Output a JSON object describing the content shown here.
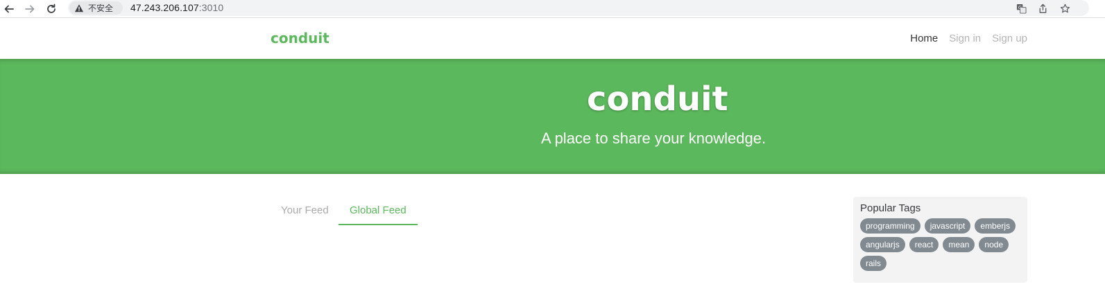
{
  "browser": {
    "security_label": "不安全",
    "url_host": "47.243.206.107",
    "url_port": ":3010"
  },
  "navbar": {
    "brand": "conduit",
    "links": [
      {
        "label": "Home",
        "active": true
      },
      {
        "label": "Sign in",
        "active": false
      },
      {
        "label": "Sign up",
        "active": false
      }
    ]
  },
  "banner": {
    "title": "conduit",
    "tagline": "A place to share your knowledge."
  },
  "feed": {
    "tabs": [
      {
        "label": "Your Feed",
        "active": false
      },
      {
        "label": "Global Feed",
        "active": true
      }
    ]
  },
  "sidebar": {
    "title": "Popular Tags",
    "tags": [
      "programming",
      "javascript",
      "emberjs",
      "angularjs",
      "react",
      "mean",
      "node",
      "rails"
    ]
  },
  "colors": {
    "brand_green": "#5cb85c",
    "tag_gray": "#818a91",
    "sidebar_bg": "#f3f3f3"
  }
}
